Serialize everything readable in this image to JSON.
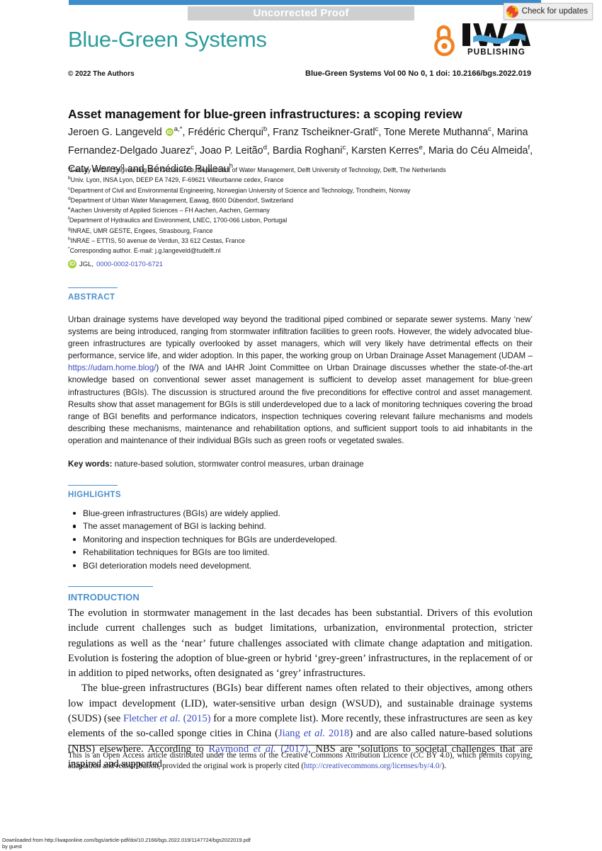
{
  "header": {
    "proof_banner": "Uncorrected Proof",
    "crossmark_label": "Check for updates",
    "crossmark_icon": "crossmark-badge-icon",
    "journal_masthead": "Blue-Green Systems",
    "open_access_icon": "open-access-lock-icon",
    "publisher_mark": "IWA",
    "publisher_sub": "PUBLISHING",
    "copyright": "© 2022 The Authors",
    "citation_line": "Blue-Green Systems Vol 00 No 0, 1 doi: 10.2166/bgs.2022.019"
  },
  "article": {
    "title": "Asset management for blue-green infrastructures: a scoping review",
    "authors_html": "Jeroen G. Langeveld <span class=\"orcid-ico\" data-name=\"orcid-icon\" data-interactable=\"true\">iD</span><sup>a,*</sup>, Frédéric Cherqui<sup>b</sup>, Franz Tscheikner-Gratl<sup>c</sup>, Tone Merete Muthanna<sup>c</sup>, Marina Fernandez-Delgado Juarez<sup>c</sup>, Joao P. Leitão<sup>d</sup>, Bardia Roghani<sup>c</sup>, Karsten Kerres<sup>e</sup>, Maria do Céu Almeida<sup>f</sup>, Caty Werey<sup>g</sup> and Bénédicte Rulleau<sup>h</sup>",
    "affiliations": [
      {
        "marker": "a",
        "text": "Faculty of Civil Engineering and Geoscience, Department of Water Management, Delft University of Technology, Delft, The Netherlands"
      },
      {
        "marker": "b",
        "text": "Univ. Lyon, INSA Lyon, DEEP EA 7429, F-69621 Villeurbanne cedex, France"
      },
      {
        "marker": "c",
        "text": "Department of Civil and Environmental Engineering, Norwegian University of Science and Technology, Trondheim, Norway"
      },
      {
        "marker": "d",
        "text": "Department of Urban Water Management, Eawag, 8600 Dübendorf, Switzerland"
      },
      {
        "marker": "e",
        "text": "Aachen University of Applied Sciences – FH Aachen, Aachen, Germany"
      },
      {
        "marker": "f",
        "text": "Department of Hydraulics and Environment, LNEC, 1700-066 Lisbon, Portugal"
      },
      {
        "marker": "g",
        "text": "INRAE, UMR GESTE, Engees, Strasbourg, France"
      },
      {
        "marker": "h",
        "text": "INRAE – ETTIS, 50 avenue de Verdun, 33 612 Cestas, France"
      },
      {
        "marker": "*",
        "text": "Corresponding author. E-mail: j.g.langeveld@tudelft.nl"
      }
    ],
    "orcid": {
      "icon": "orcid-icon",
      "author_initials": "JGL,",
      "id": "0000-0002-0170-6721"
    }
  },
  "sections": {
    "abstract_heading": "ABSTRACT",
    "abstract_html": "Urban drainage systems have developed way beyond the traditional piped combined or separate sewer systems. Many ‘new’ systems are being introduced, ranging from stormwater infiltration facilities to green roofs. However, the widely advocated blue-green infrastructures are typically overlooked by asset managers, which will very likely have detrimental effects on their performance, service life, and wider adoption. In this paper, the working group on Urban Drainage Asset Management (UDAM – <a href=\"#\" class=\"link\" data-name=\"udam-link\" data-interactable=\"true\">https://udam.home.blog/</a>) of the IWA and IAHR Joint Committee on Urban Drainage discusses whether the state-of-the-art knowledge based on conventional sewer asset management is sufficient to develop asset management for blue-green infrastructures (BGIs). The discussion is structured around the five preconditions for effective control and asset management. Results show that asset management for BGIs is still underdeveloped due to a lack of monitoring techniques covering the broad range of BGI benefits and performance indicators, inspection techniques covering relevant failure mechanisms and models describing these mechanisms, maintenance and rehabilitation options, and sufficient support tools to aid inhabitants in the operation and maintenance of their individual BGIs such as green roofs or vegetated swales.",
    "keywords_label": "Key words:",
    "keywords_value": "nature-based solution, stormwater control measures, urban drainage",
    "highlights_heading": "HIGHLIGHTS",
    "highlights": [
      "Blue-green infrastructures (BGIs) are widely applied.",
      "The asset management of BGI is lacking behind.",
      "Monitoring and inspection techniques for BGIs are underdeveloped.",
      "Rehabilitation techniques for BGIs are too limited.",
      "BGI deterioration models need development."
    ],
    "introduction_heading": "INTRODUCTION",
    "introduction_paragraphs_html": [
      "The evolution in stormwater management in the last decades has been substantial. Drivers of this evolution include current challenges such as budget limitations, urbanization, environmental protection, stricter regulations as well as the ‘near’ future challenges associated with climate change adaptation and mitigation. Evolution is fostering the adoption of blue-green or hybrid ‘grey-green’ infrastructures, in the replacement of or in addition to piped networks, often designated as ‘grey’ infrastructures.",
      "The blue-green infrastructures (BGIs) bear different names often related to their objectives, among others low impact development (LID), water-sensitive urban design (WSUD), and sustainable drainage systems (SUDS) (see <span class=\"cite\" data-name=\"citation-fletcher\" data-interactable=\"true\">Fletcher <i>et al.</i> (2015)</span> for a more complete list). More recently, these infrastructures are seen as key elements of the so-called sponge cities in China (<span class=\"cite\" data-name=\"citation-jiang\" data-interactable=\"true\">Jiang <i>et al.</i> 2018</span>) and are also called nature-based solutions (NBS) elsewhere. According to <span class=\"cite\" data-name=\"citation-raymond\" data-interactable=\"true\">Raymond <i>et al.</i> (2017)</span>, NBS are ‘solutions to societal challenges that are inspired and supported"
    ]
  },
  "licence": {
    "text_before_link": "This is an Open Access article distributed under the terms of the Creative Commons Attribution Licence (CC BY 4.0), which permits copying, adaptation and redistribution, provided the original work is properly cited (",
    "link": "http://creativecommons.org/licenses/by/4.0/",
    "text_after_link": ")."
  },
  "footer": {
    "line1": "Downloaded from http://iwaponline.com/bgs/article-pdf/doi/10.2166/bgs.2022.019/1147724/bgs2022019.pdf",
    "line2": "by guest"
  },
  "colors": {
    "rule_blue": "#3d8dcc",
    "masthead_teal": "#2b9d9c",
    "section_heading_blue": "#4a90cf",
    "link_blue": "#3b4cc0",
    "open_access_orange": "#f08122",
    "orcid_green": "#a6ce39",
    "banner_gray": "#cfcfcf"
  }
}
